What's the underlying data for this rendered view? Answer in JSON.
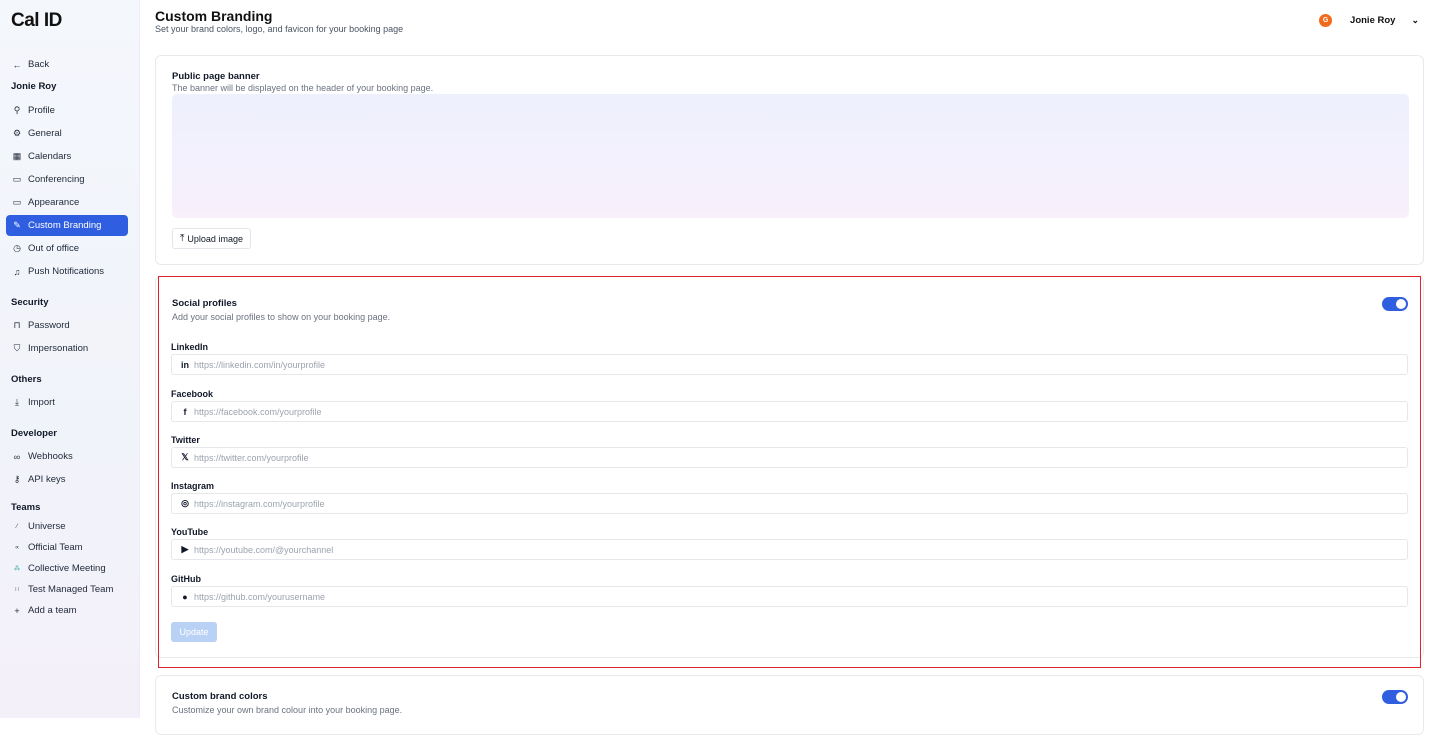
{
  "app": {
    "logo": "Cal ID"
  },
  "sidebar": {
    "back": "Back",
    "user_name": "Jonie Roy",
    "items": [
      {
        "label": "Profile",
        "icon": "user-icon"
      },
      {
        "label": "General",
        "icon": "gear-icon"
      },
      {
        "label": "Calendars",
        "icon": "calendar-icon"
      },
      {
        "label": "Conferencing",
        "icon": "video-icon"
      },
      {
        "label": "Appearance",
        "icon": "monitor-icon"
      },
      {
        "label": "Custom Branding",
        "icon": "brush-icon",
        "active": true
      },
      {
        "label": "Out of office",
        "icon": "clock-icon"
      },
      {
        "label": "Push Notifications",
        "icon": "bell-icon"
      }
    ],
    "security_head": "Security",
    "security_items": [
      {
        "label": "Password",
        "icon": "lock-icon"
      },
      {
        "label": "Impersonation",
        "icon": "shield-icon"
      }
    ],
    "others_head": "Others",
    "others_items": [
      {
        "label": "Import",
        "icon": "download-icon"
      }
    ],
    "developer_head": "Developer",
    "developer_items": [
      {
        "label": "Webhooks",
        "icon": "webhook-icon"
      },
      {
        "label": "API keys",
        "icon": "key-icon"
      }
    ],
    "teams_head": "Teams",
    "teams_items": [
      {
        "label": "Universe",
        "icon": "team-logo-icon"
      },
      {
        "label": "Official Team",
        "icon": "team-logo-icon"
      },
      {
        "label": "Collective Meeting",
        "icon": "team-logo-icon"
      },
      {
        "label": "Test Managed Team",
        "icon": "team-logo-icon"
      },
      {
        "label": "Add a team",
        "icon": "plus-icon"
      }
    ]
  },
  "header": {
    "title": "Custom Branding",
    "subtitle": "Set your brand colors, logo, and favicon for your booking page",
    "user_name": "Jonie Roy",
    "avatar_initial": "G"
  },
  "banner_card": {
    "title": "Public page banner",
    "description": "The banner will be displayed on the header of your booking page.",
    "upload_label": "Upload image"
  },
  "social_card": {
    "title": "Social profiles",
    "description": "Add your social profiles to show on your booking page.",
    "enabled": true,
    "fields": [
      {
        "label": "LinkedIn",
        "placeholder": "https://linkedin.com/in/yourprofile",
        "icon": "linkedin-icon",
        "glyph": "in"
      },
      {
        "label": "Facebook",
        "placeholder": "https://facebook.com/yourprofile",
        "icon": "facebook-icon",
        "glyph": "f"
      },
      {
        "label": "Twitter",
        "placeholder": "https://twitter.com/yourprofile",
        "icon": "x-icon",
        "glyph": "𝕏"
      },
      {
        "label": "Instagram",
        "placeholder": "https://instagram.com/yourprofile",
        "icon": "instagram-icon",
        "glyph": "◎"
      },
      {
        "label": "YouTube",
        "placeholder": "https://youtube.com/@yourchannel",
        "icon": "youtube-icon",
        "glyph": "▶"
      },
      {
        "label": "GitHub",
        "placeholder": "https://github.com/yourusername",
        "icon": "github-icon",
        "glyph": "●"
      }
    ],
    "update_label": "Update"
  },
  "colors_card": {
    "title": "Custom brand colors",
    "description": "Customize your own brand colour into your booking page.",
    "enabled": true
  },
  "colors": {
    "accent": "#2f5ee0",
    "highlight_border": "#e0242f",
    "avatar": "#f26b1d"
  }
}
